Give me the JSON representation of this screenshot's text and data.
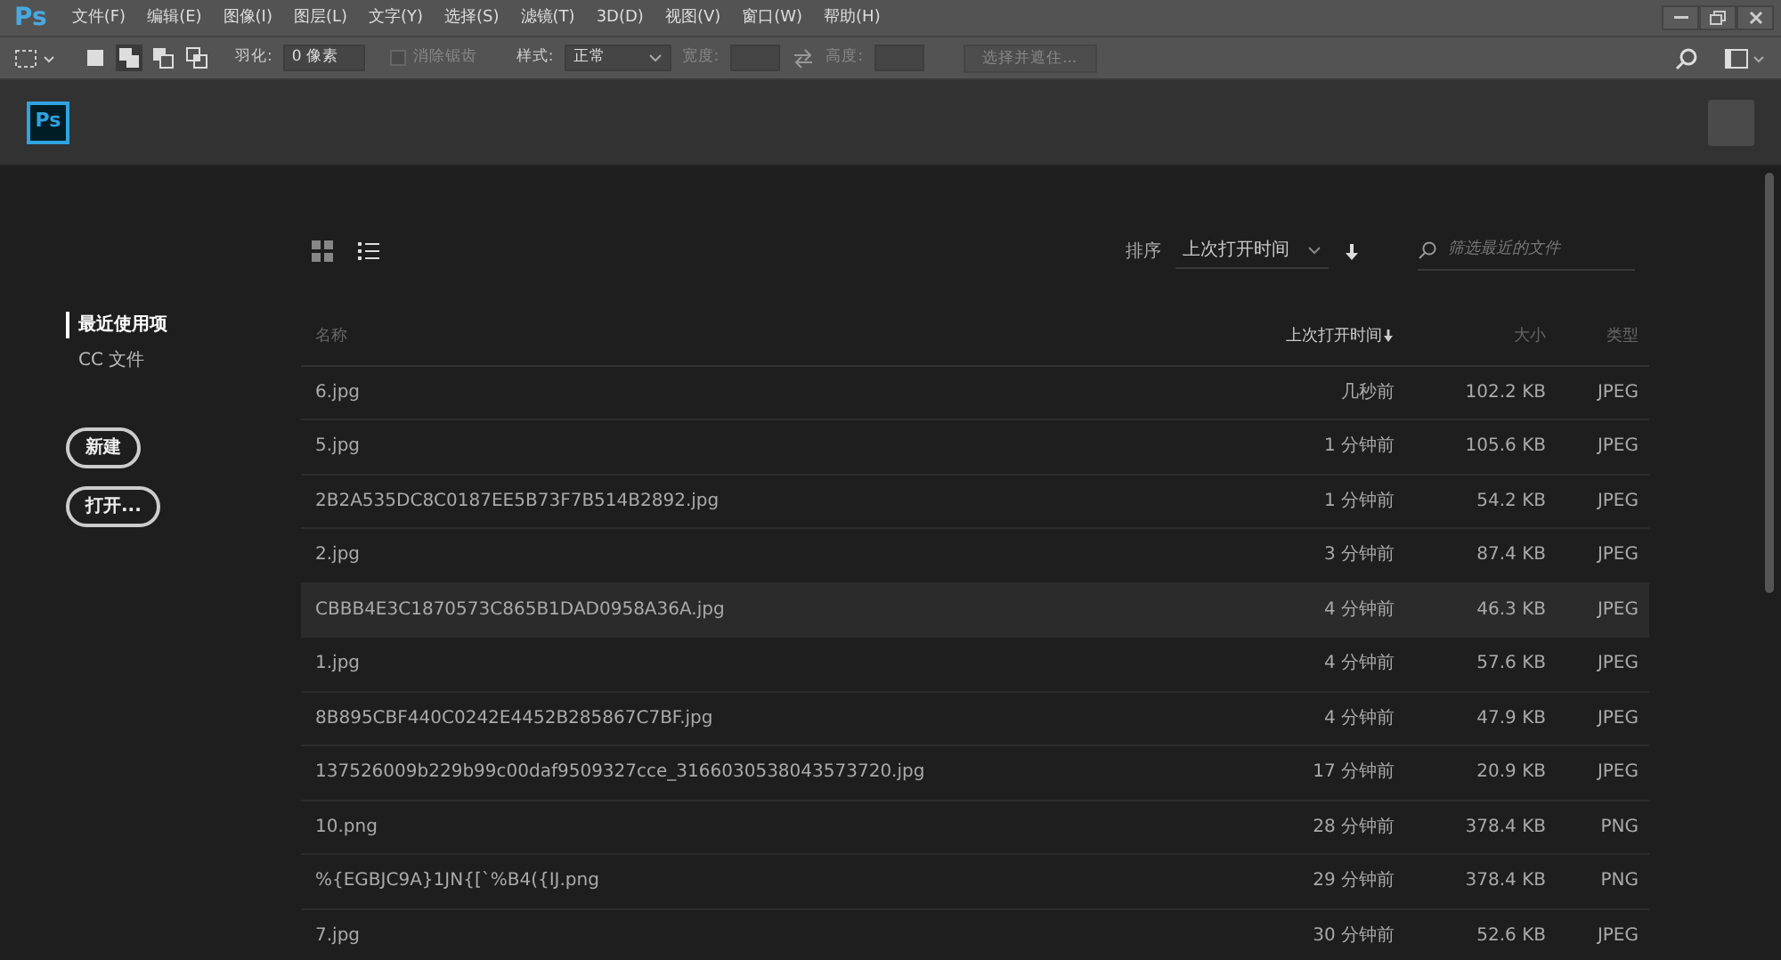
{
  "menu_bar": {
    "logo": "Ps",
    "items": [
      "文件(F)",
      "编辑(E)",
      "图像(I)",
      "图层(L)",
      "文字(Y)",
      "选择(S)",
      "滤镜(T)",
      "3D(D)",
      "视图(V)",
      "窗口(W)",
      "帮助(H)"
    ]
  },
  "options_bar": {
    "modes": [
      {
        "selected": false
      },
      {
        "selected": true
      },
      {
        "selected": false
      },
      {
        "selected": false
      }
    ],
    "feather_label": "羽化:",
    "feather_value": "0 像素",
    "antialias": {
      "label": "消除锯齿",
      "checked": false,
      "disabled": true
    },
    "style_label": "样式:",
    "style_value": "正常",
    "width_label": "宽度:",
    "height_label": "高度:",
    "select_mask_button": "选择并遮住..."
  },
  "home": {
    "logo": "Ps"
  },
  "sidebar": {
    "items": [
      {
        "label": "最近使用项",
        "selected": true
      },
      {
        "label": "CC 文件",
        "selected": false
      }
    ],
    "buttons": [
      "新建",
      "打开..."
    ]
  },
  "toolbar": {
    "views": [
      {
        "kind": "grid",
        "selected": false
      },
      {
        "kind": "list",
        "selected": true
      }
    ],
    "sort_label": "排序",
    "sort_value": "上次打开时间",
    "filter_placeholder": "筛选最近的文件"
  },
  "table": {
    "columns": [
      "名称",
      "上次打开时间",
      "大小",
      "类型"
    ],
    "rows": [
      {
        "name": "6.jpg",
        "opened": "几秒前",
        "size": "102.2 KB",
        "type": "JPEG",
        "selected": false
      },
      {
        "name": "5.jpg",
        "opened": "1 分钟前",
        "size": "105.6 KB",
        "type": "JPEG",
        "selected": false
      },
      {
        "name": "2B2A535DC8C0187EE5B73F7B514B2892.jpg",
        "opened": "1 分钟前",
        "size": "54.2 KB",
        "type": "JPEG",
        "selected": false
      },
      {
        "name": "2.jpg",
        "opened": "3 分钟前",
        "size": "87.4 KB",
        "type": "JPEG",
        "selected": false
      },
      {
        "name": "CBBB4E3C1870573C865B1DAD0958A36A.jpg",
        "opened": "4 分钟前",
        "size": "46.3 KB",
        "type": "JPEG",
        "selected": true
      },
      {
        "name": "1.jpg",
        "opened": "4 分钟前",
        "size": "57.6 KB",
        "type": "JPEG",
        "selected": false
      },
      {
        "name": "8B895CBF440C0242E4452B285867C7BF.jpg",
        "opened": "4 分钟前",
        "size": "47.9 KB",
        "type": "JPEG",
        "selected": false
      },
      {
        "name": "137526009b229b99c00daf9509327cce_3166030538043573720.jpg",
        "opened": "17 分钟前",
        "size": "20.9 KB",
        "type": "JPEG",
        "selected": false
      },
      {
        "name": "10.png",
        "opened": "28 分钟前",
        "size": "378.4 KB",
        "type": "PNG",
        "selected": false
      },
      {
        "name": "%{EGBJC9A}1JN{[`%B4({IJ.png",
        "opened": "29 分钟前",
        "size": "378.4 KB",
        "type": "PNG",
        "selected": false
      },
      {
        "name": "7.jpg",
        "opened": "30 分钟前",
        "size": "52.6 KB",
        "type": "JPEG",
        "selected": false
      }
    ]
  }
}
